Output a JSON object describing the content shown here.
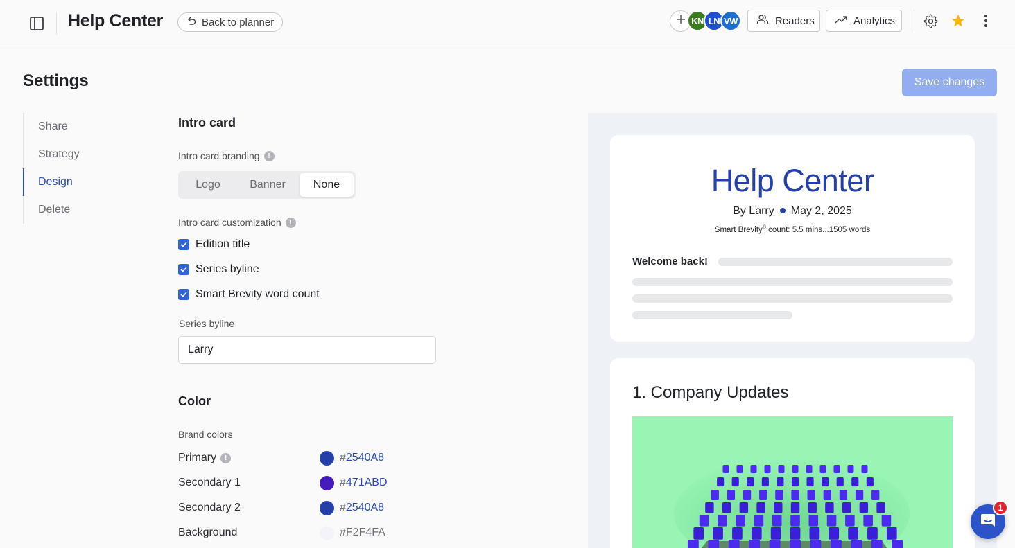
{
  "app": {
    "title": "Help Center",
    "back_label": "Back to planner"
  },
  "collaborators": [
    {
      "initials": "KN",
      "color": "#3a7d1e"
    },
    {
      "initials": "LN",
      "color": "#1f4fd1"
    },
    {
      "initials": "VW",
      "color": "#1f6fd1"
    }
  ],
  "toolbar": {
    "readers_label": "Readers",
    "analytics_label": "Analytics",
    "favorite_color": "#f5b70a"
  },
  "page": {
    "title": "Settings",
    "save_label": "Save changes"
  },
  "settings_nav": [
    {
      "label": "Share",
      "active": false
    },
    {
      "label": "Strategy",
      "active": false
    },
    {
      "label": "Design",
      "active": true
    },
    {
      "label": "Delete",
      "active": false
    }
  ],
  "intro_card": {
    "title": "Intro card",
    "branding_label": "Intro card branding",
    "branding_options": [
      "Logo",
      "Banner",
      "None"
    ],
    "branding_selected": "None",
    "customization_label": "Intro card customization",
    "checkboxes": [
      {
        "label": "Edition title",
        "checked": true
      },
      {
        "label": "Series byline",
        "checked": true
      },
      {
        "label": "Smart Brevity word count",
        "checked": true
      }
    ],
    "byline_label": "Series byline",
    "byline_value": "Larry"
  },
  "color": {
    "title": "Color",
    "brand_label": "Brand colors",
    "rows": [
      {
        "name": "Primary",
        "hex": "2540A8",
        "swatch": "#2540A8",
        "info": true
      },
      {
        "name": "Secondary 1",
        "hex": "471ABD",
        "swatch": "#471ABD",
        "info": false
      },
      {
        "name": "Secondary 2",
        "hex": "2540A8",
        "swatch": "#2540A8",
        "info": false
      },
      {
        "name": "Background",
        "hex": "F2F4FA",
        "swatch": "#F2F4FA",
        "info": false
      }
    ]
  },
  "preview": {
    "title": "Help Center",
    "byline": "By Larry",
    "date": "May 2, 2025",
    "count_prefix": "Smart Brevity",
    "count_mark": "®",
    "count_suffix": " count: 5.5 mins...1505 words",
    "welcome": "Welcome back!",
    "section_heading": "1. Company Updates"
  },
  "help": {
    "badge_count": "1"
  },
  "accent": "#2b4db0"
}
